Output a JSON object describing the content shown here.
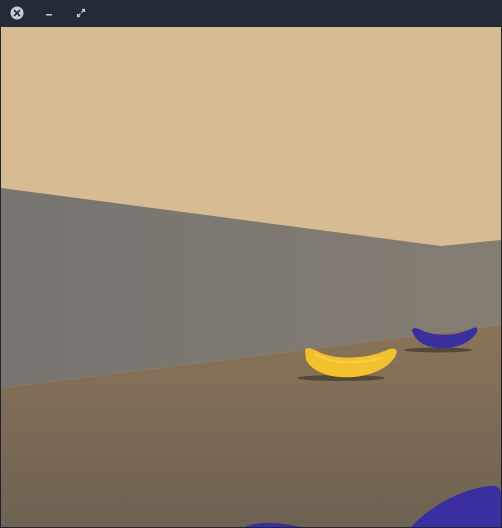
{
  "window": {
    "title": "",
    "controls": [
      {
        "name": "close",
        "icon": "close-icon"
      },
      {
        "name": "minimize",
        "icon": "minimize-icon"
      },
      {
        "name": "maximize",
        "icon": "maximize-icon"
      }
    ]
  },
  "scene": {
    "description_items": [
      "sky",
      "wall",
      "floor",
      "yellow-banana",
      "blue-banana-far",
      "blue-banana-near"
    ],
    "colors": {
      "sky": "#d7bb93",
      "wall": "#7d7872",
      "floor": "#8c7659",
      "yellow_banana": "#f2c12e",
      "blue_banana": "#3a2f9e"
    }
  }
}
